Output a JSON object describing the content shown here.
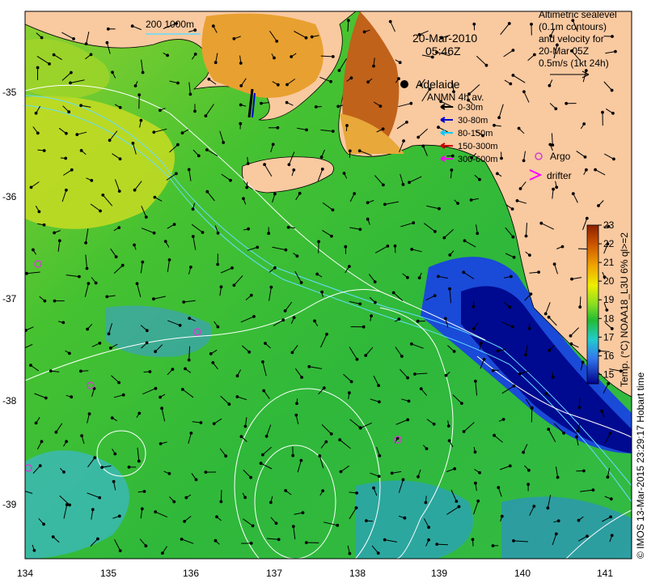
{
  "map": {
    "date": "20-Mar-2010",
    "time": "05:46Z",
    "city": "Adelaide",
    "scale_label": "200  1000m",
    "altimetry_note": [
      "Altimetric sealevel",
      "(0.1m contours)",
      "and velocity for",
      "20-Mar 05Z",
      "0.5m/s (1kt 24h)"
    ],
    "lon_ticks": [
      "134",
      "135",
      "136",
      "137",
      "138",
      "139",
      "140",
      "141"
    ],
    "lat_ticks": [
      "-35",
      "-36",
      "-37",
      "-38",
      "-39"
    ],
    "lon_range": [
      134,
      141.3
    ],
    "lat_range": [
      -39.6,
      -34.4
    ],
    "anmn": {
      "title": "ANMN 4h av.",
      "depths": [
        {
          "label": "0-30m",
          "color": "#000000"
        },
        {
          "label": "30-80m",
          "color": "#0000cc"
        },
        {
          "label": "80-150m",
          "color": "#00ccff"
        },
        {
          "label": "150-300m",
          "color": "#cc0000"
        },
        {
          "label": "300-600m",
          "color": "#ff00ff"
        }
      ]
    },
    "markers": {
      "argo": "Argo",
      "drifter": "drifter"
    },
    "colorbar": {
      "label": "Temp. (°C) NOAA18_L3U 6% ql>=2",
      "ticks": [
        "15",
        "16",
        "17",
        "18",
        "19",
        "20",
        "21",
        "22",
        "23"
      ],
      "range": [
        14.5,
        23
      ]
    },
    "credit": "© IMOS 13-Mar-2015 23:29:17 Hobart time",
    "colors": {
      "land": "#f9c9a0",
      "argo": "#cc44cc",
      "contour": "#ffffff",
      "bathy": "#66ddff"
    }
  }
}
